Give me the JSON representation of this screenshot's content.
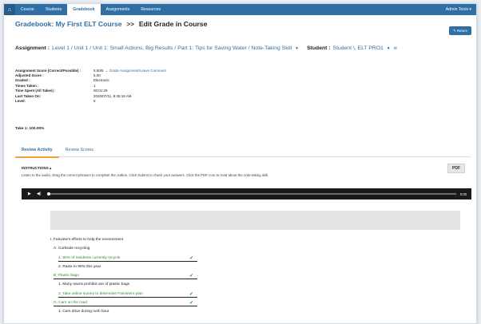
{
  "topnav": {
    "home_icon": "home-icon",
    "items": [
      "Course",
      "Students",
      "Gradebook",
      "Assignments",
      "Resources"
    ],
    "active": "Gradebook",
    "admin_label": "Admin Tools ▾"
  },
  "title": {
    "course": "Gradebook: My First ELT Course",
    "separator": ">>",
    "page": "Edit Grade in Course",
    "return_label": "↰ Return"
  },
  "assignment": {
    "label": "Assignment :",
    "path": "Level 1 / Unit 1 / Unit 1: Small Actions, Big Results / Part 1: Tips for Saving Water / Note-Taking Skill",
    "student_label": "Student :",
    "student": "Student \\, ELT PRO1"
  },
  "info": [
    {
      "k": "Assignment Score (Correct/Possible) :",
      "v": "5.00/5 → ",
      "link": "Grade Assignment/Leave Comment"
    },
    {
      "k": "Adjusted Score :",
      "v": "5.00"
    },
    {
      "k": "Graded :",
      "v": "Electronic"
    },
    {
      "k": "Times Taken :",
      "v": "1"
    },
    {
      "k": "Time Spent (All Takes) :",
      "v": "00:01:29"
    },
    {
      "k": "Last Taken On:",
      "v": "2020/07/11, 8:45:16 AM"
    },
    {
      "k": "Level:",
      "v": "5"
    }
  ],
  "take": "Take 1: 100.00%",
  "tabs": [
    "Review Activity",
    "Review Scores"
  ],
  "instructions": {
    "title": "INSTRUCTIONS ▴",
    "text": "Listen to the audio. Drag the correct phrases to complete the outline. Click Submit to check your answers. Click the PDF icon to read about the note-taking skill.",
    "pdf_label": "PDF"
  },
  "player": {
    "time": "0:00"
  },
  "outline": [
    {
      "type": "text",
      "text": "I. Fairview's efforts to help the environment"
    },
    {
      "type": "text",
      "text": "A. Curbside recycling"
    },
    {
      "type": "answer",
      "text": "1.  80% of residents currently recycle",
      "check": "✔"
    },
    {
      "type": "text",
      "text": "2. Raise to 90% this year"
    },
    {
      "type": "answer",
      "text": "B.  Plastic bags",
      "check": "✔"
    },
    {
      "type": "text",
      "text": "1. Many towns prohibit use of plastic bags"
    },
    {
      "type": "answer",
      "text": "2.  Take online survey to determine Fairview's plan",
      "check": "✔"
    },
    {
      "type": "answer",
      "text": "C.  Cars on the road",
      "check": "✔"
    },
    {
      "type": "text",
      "text": "1. Cars drive during rush hour"
    }
  ],
  "colors": {
    "accent": "#2f6fa5",
    "correct": "#2e8b2e",
    "tab_underline": "#f0a23b"
  }
}
